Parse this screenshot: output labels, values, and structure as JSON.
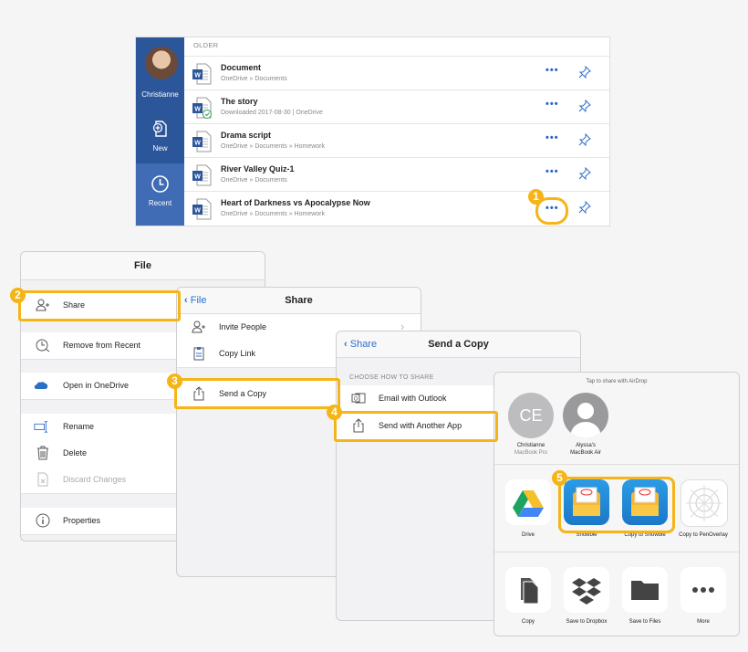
{
  "recents": {
    "section": "OLDER",
    "sidebar": {
      "user": "Christianne",
      "new_label": "New",
      "recent_label": "Recent"
    },
    "docs": [
      {
        "title": "Document",
        "path": "OneDrive » Documents"
      },
      {
        "title": "The story",
        "path": "Downloaded 2017-08-30 | OneDrive"
      },
      {
        "title": "Drama script",
        "path": "OneDrive » Documents » Homework"
      },
      {
        "title": "River Valley Quiz-1",
        "path": "OneDrive » Documents"
      },
      {
        "title": "Heart of Darkness vs Apocalypse Now",
        "path": "OneDrive » Documents » Homework"
      }
    ],
    "more": "•••"
  },
  "steps": [
    "1",
    "2",
    "3",
    "4",
    "5"
  ],
  "file_menu": {
    "title": "File",
    "items": [
      "Share",
      "Remove from Recent",
      "Open in OneDrive",
      "Rename",
      "Delete",
      "Discard Changes",
      "Properties"
    ]
  },
  "share_menu": {
    "back": "File",
    "title": "Share",
    "items": [
      "Invite People",
      "Copy Link",
      "Send a Copy"
    ]
  },
  "send_copy": {
    "back": "Share",
    "title": "Send a Copy",
    "section": "CHOOSE HOW TO SHARE",
    "items": [
      "Email with Outlook",
      "Send with Another App"
    ]
  },
  "share_sheet": {
    "airdrop_hint": "Tap to share with AirDrop",
    "people": [
      {
        "initials": "CE",
        "name": "Christianne",
        "device": "MacBook Pro"
      },
      {
        "initials": "",
        "name": "Alyssa's",
        "device": "MacBook Air"
      }
    ],
    "apps": [
      "Drive",
      "Showbie",
      "Copy to Showbie",
      "Copy to PenOverlay"
    ],
    "actions": [
      "Copy",
      "Save to Dropbox",
      "Save to Files",
      "More"
    ]
  },
  "colors": {
    "accent": "#f5b417",
    "office_blue": "#2b569a",
    "link_blue": "#2d6fd0"
  }
}
